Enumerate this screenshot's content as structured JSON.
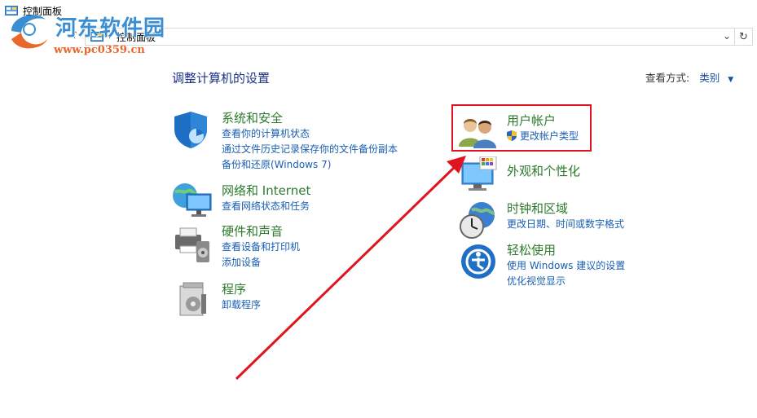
{
  "window": {
    "title": "控制面板"
  },
  "address": {
    "breadcrumb": "控制面板"
  },
  "watermark": {
    "title": "河东软件园",
    "url": "www.pc0359.cn"
  },
  "main": {
    "heading": "调整计算机的设置",
    "view_by_label": "查看方式:",
    "view_by_value": "类别"
  },
  "categories_left": [
    {
      "title": "系统和安全",
      "links": [
        "查看你的计算机状态",
        "通过文件历史记录保存你的文件备份副本",
        "备份和还原(Windows 7)"
      ]
    },
    {
      "title": "网络和 Internet",
      "links": [
        "查看网络状态和任务"
      ]
    },
    {
      "title": "硬件和声音",
      "links": [
        "查看设备和打印机",
        "添加设备"
      ]
    },
    {
      "title": "程序",
      "links": [
        "卸载程序"
      ]
    }
  ],
  "categories_right": [
    {
      "title": "用户帐户",
      "links": [
        "更改帐户类型"
      ]
    },
    {
      "title": "外观和个性化",
      "links": []
    },
    {
      "title": "时钟和区域",
      "links": [
        "更改日期、时间或数字格式"
      ]
    },
    {
      "title": "轻松使用",
      "links": [
        "使用 Windows 建议的设置",
        "优化视觉显示"
      ]
    }
  ],
  "annotation_color": "#e0141e"
}
